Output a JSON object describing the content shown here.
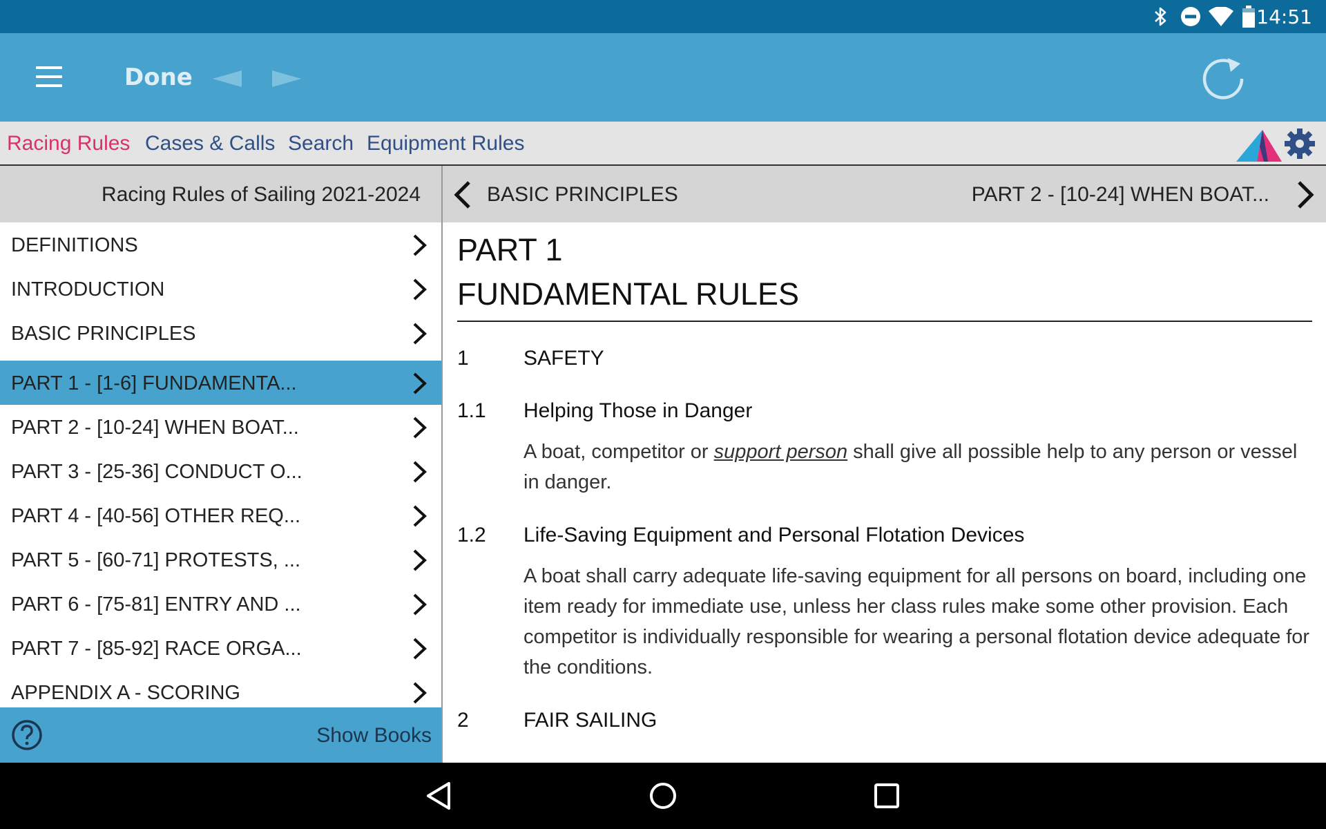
{
  "status_bar": {
    "time": "14:51",
    "icons": [
      "bluetooth-icon",
      "do-not-disturb-icon",
      "wifi-icon",
      "battery-icon"
    ]
  },
  "toolbar": {
    "done_label": "Done",
    "icons": [
      "menu-icon",
      "back-arrow-icon",
      "forward-arrow-icon",
      "refresh-icon"
    ]
  },
  "tabs": [
    {
      "label": "Racing Rules",
      "active": true
    },
    {
      "label": "Cases & Calls",
      "active": false
    },
    {
      "label": "Search",
      "active": false
    },
    {
      "label": "Equipment Rules",
      "active": false
    }
  ],
  "left_panel": {
    "title": "Racing Rules of Sailing 2021-2024",
    "items": [
      {
        "label": "DEFINITIONS"
      },
      {
        "label": "INTRODUCTION"
      },
      {
        "label": "BASIC PRINCIPLES"
      },
      {
        "label": "PART 1 - [1-6] FUNDAMENTA...",
        "selected": true
      },
      {
        "label": "PART 2 - [10-24] WHEN BOAT..."
      },
      {
        "label": "PART 3 - [25-36] CONDUCT O..."
      },
      {
        "label": "PART 4 - [40-56] OTHER REQ..."
      },
      {
        "label": "PART 5 - [60-71] PROTESTS, ..."
      },
      {
        "label": "PART 6 - [75-81] ENTRY AND ..."
      },
      {
        "label": "PART 7 - [85-92] RACE ORGA..."
      },
      {
        "label": "APPENDIX A - SCORING"
      }
    ],
    "footer": {
      "show_books_label": "Show Books",
      "help_icon": "help-icon"
    }
  },
  "right_panel": {
    "prev_label": "BASIC PRINCIPLES",
    "next_label": "PART 2 - [10-24] WHEN BOAT...",
    "part_number": "PART 1",
    "part_title": "FUNDAMENTAL RULES",
    "rules": [
      {
        "number": "1",
        "heading": "SAFETY"
      },
      {
        "number": "1.1",
        "heading": "Helping Those in Danger",
        "body_before": "A boat, competitor or ",
        "term": "support person",
        "body_after": " shall give all possible help to any person or vessel in danger."
      },
      {
        "number": "1.2",
        "heading": "Life-Saving Equipment and Personal Flotation Devices",
        "body": "A boat shall carry adequate life-saving equipment for all persons on board, including one item ready for immediate use, unless her class rules make some other provision. Each competitor is individually responsible for wearing a personal flotation device adequate for the conditions."
      },
      {
        "number": "2",
        "heading": "FAIR SAILING"
      }
    ]
  },
  "colors": {
    "status_bar": "#0d6b9c",
    "action_bar": "#47a3cd",
    "tab_active": "#d6336c",
    "tab_inactive": "#2f4f86",
    "selected_row": "#47a3cd",
    "header_gray": "#d5d5d5"
  },
  "system_nav": {
    "icons": [
      "back-triangle-icon",
      "home-circle-icon",
      "recents-square-icon"
    ]
  }
}
